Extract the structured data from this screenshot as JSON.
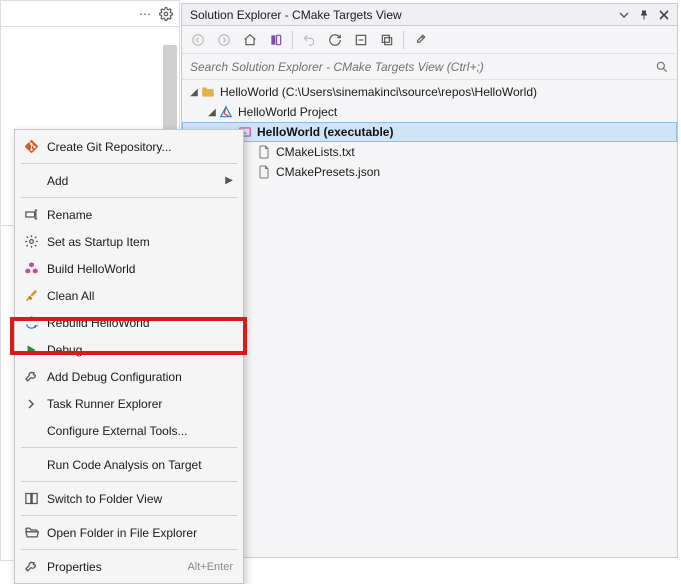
{
  "panel": {
    "title": "Solution Explorer - CMake Targets View",
    "search_placeholder": "Search Solution Explorer - CMake Targets View (Ctrl+;)"
  },
  "tree": {
    "root": "HelloWorld (C:\\Users\\sinemakinci\\source\\repos\\HelloWorld)",
    "project": "HelloWorld Project",
    "target": "HelloWorld (executable)",
    "file_lists": "CMakeLists.txt",
    "file_presets": "CMakePresets.json"
  },
  "context_menu": {
    "create_git": "Create Git Repository...",
    "add": "Add",
    "rename": "Rename",
    "set_startup": "Set as Startup Item",
    "build": "Build HelloWorld",
    "clean": "Clean All",
    "rebuild": "Rebuild HelloWorld",
    "debug": "Debug",
    "add_debug_config": "Add Debug Configuration",
    "task_runner": "Task Runner Explorer",
    "configure_tools": "Configure External Tools...",
    "run_code_analysis": "Run Code Analysis on Target",
    "switch_folder_view": "Switch to Folder View",
    "open_in_explorer": "Open Folder in File Explorer",
    "properties": "Properties",
    "properties_accel": "Alt+Enter"
  }
}
